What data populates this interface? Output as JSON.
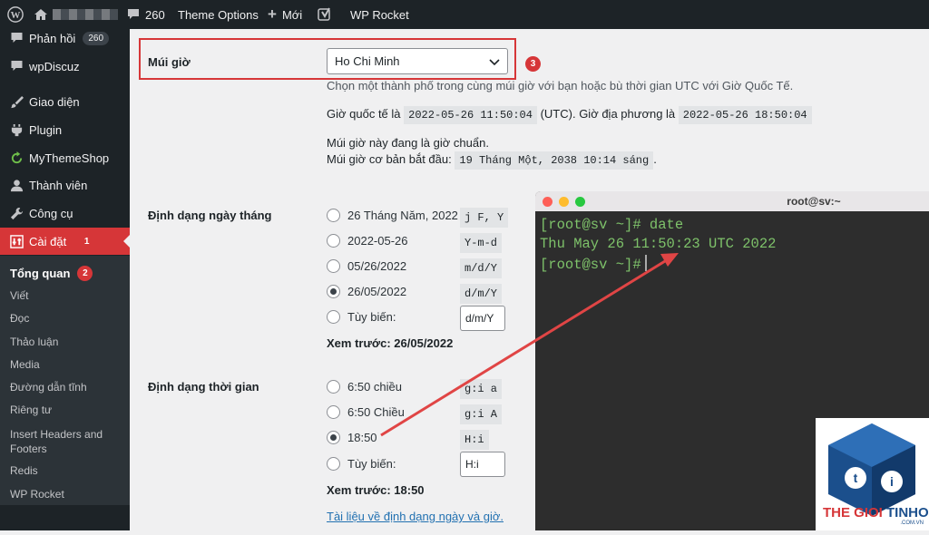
{
  "adminbar": {
    "comments_count": "260",
    "theme_options": "Theme Options",
    "new_label": "Mới",
    "wp_rocket": "WP Rocket"
  },
  "sidebar": {
    "items": [
      {
        "label": "Phản hồi",
        "icon": "comment-icon",
        "badge": "260"
      },
      {
        "label": "wpDiscuz",
        "icon": "comment-icon"
      },
      {
        "label": "Giao diện",
        "icon": "brush-icon"
      },
      {
        "label": "Plugin",
        "icon": "plugin-icon"
      },
      {
        "label": "MyThemeShop",
        "icon": "refresh-icon"
      },
      {
        "label": "Thành viên",
        "icon": "user-icon"
      },
      {
        "label": "Công cụ",
        "icon": "wrench-icon"
      },
      {
        "label": "Cài đặt",
        "icon": "settings-icon",
        "badge": "1"
      }
    ],
    "submenu": [
      {
        "label": "Tổng quan",
        "badge": "2"
      },
      {
        "label": "Viết"
      },
      {
        "label": "Đọc"
      },
      {
        "label": "Thảo luận"
      },
      {
        "label": "Media"
      },
      {
        "label": "Đường dẫn tĩnh"
      },
      {
        "label": "Riêng tư"
      },
      {
        "label": "Insert Headers and Footers"
      },
      {
        "label": "Redis"
      },
      {
        "label": "WP Rocket"
      }
    ]
  },
  "timezone": {
    "label": "Múi giờ",
    "selected": "Ho Chi Minh",
    "marker": "3",
    "help": "Chọn một thành phố trong cùng múi giờ với bạn hoặc bù thời gian UTC với Giờ Quốc Tế.",
    "utc_prefix": "Giờ quốc tế là",
    "utc_value": "2022-05-26 11:50:04",
    "utc_suffix": "(UTC). Giờ địa phương là",
    "local_value": "2022-05-26 18:50:04",
    "standard_note": "Múi giờ này đang là giờ chuẩn.",
    "base_prefix": "Múi giờ cơ bản bắt đầu:",
    "base_value": "19 Tháng Một, 2038 10:14 sáng",
    "base_suffix": "."
  },
  "date_format": {
    "label": "Định dạng ngày tháng",
    "options": [
      {
        "label": "26 Tháng Năm, 2022",
        "format": "j F, Y",
        "checked": false
      },
      {
        "label": "2022-05-26",
        "format": "Y-m-d",
        "checked": false
      },
      {
        "label": "05/26/2022",
        "format": "m/d/Y",
        "checked": false
      },
      {
        "label": "26/05/2022",
        "format": "d/m/Y",
        "checked": true
      }
    ],
    "custom_label": "Tùy biến:",
    "custom_value": "d/m/Y",
    "preview": "Xem trước: 26/05/2022"
  },
  "time_format": {
    "label": "Định dạng thời gian",
    "options": [
      {
        "label": "6:50 chiều",
        "format": "g:i a",
        "checked": false
      },
      {
        "label": "6:50 Chiều",
        "format": "g:i A",
        "checked": false
      },
      {
        "label": "18:50",
        "format": "H:i",
        "checked": true
      }
    ],
    "custom_label": "Tùy biến:",
    "custom_value": "H:i",
    "preview": "Xem trước: 18:50",
    "doc_link": "Tài liệu về định dạng ngày và giờ."
  },
  "terminal": {
    "title": "root@sv:~",
    "line1": "[root@sv ~]# date",
    "line2": "Thu May 26 11:50:23 UTC 2022",
    "line3": "[root@sv ~]#"
  },
  "logo": {
    "text1": "THE GIOI",
    "text2": "TINHOC",
    "sub": ".COM.VN"
  },
  "colors": {
    "highlight": "#d63638",
    "accent": "#2271b1",
    "terminal_text": "#7ec26a"
  }
}
